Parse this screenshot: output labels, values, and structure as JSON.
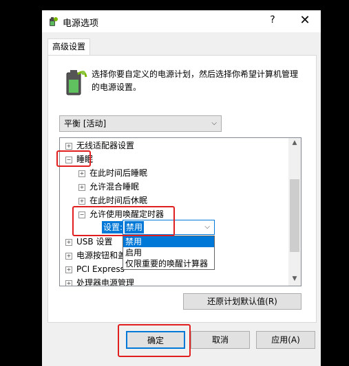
{
  "window": {
    "title": "电源选项",
    "help": "?",
    "close": "✕"
  },
  "tab": {
    "label": "高级设置"
  },
  "description": "选择你要自定义的电源计划，然后选择你希望计算机管理的电源设置。",
  "plan_select": {
    "value": "平衡 [活动]"
  },
  "tree": {
    "items": [
      {
        "label": "无线适配器设置",
        "expander": "+"
      },
      {
        "label": "睡眠",
        "expander": "−"
      },
      {
        "label": "在此时间后睡眠",
        "expander": "+"
      },
      {
        "label": "允许混合睡眠",
        "expander": "+"
      },
      {
        "label": "在此时间后休眠",
        "expander": "+"
      },
      {
        "label": "允许使用唤醒定时器",
        "expander": "−"
      },
      {
        "label": "USB 设置",
        "expander": "+"
      },
      {
        "label": "电源按钮和盖",
        "expander": "+"
      },
      {
        "label": "PCI Express",
        "expander": "+"
      },
      {
        "label": "处理器电源管理",
        "expander": "+"
      }
    ]
  },
  "setting": {
    "label": "设置:",
    "value": "禁用",
    "options": [
      "禁用",
      "启用",
      "仅限重要的唤醒计算器"
    ]
  },
  "buttons": {
    "restore": "还原计划默认值(R)",
    "ok": "确定",
    "cancel": "取消",
    "apply": "应用(A)"
  },
  "colors": {
    "accent": "#0078d7",
    "annotation": "#e01e1e"
  }
}
